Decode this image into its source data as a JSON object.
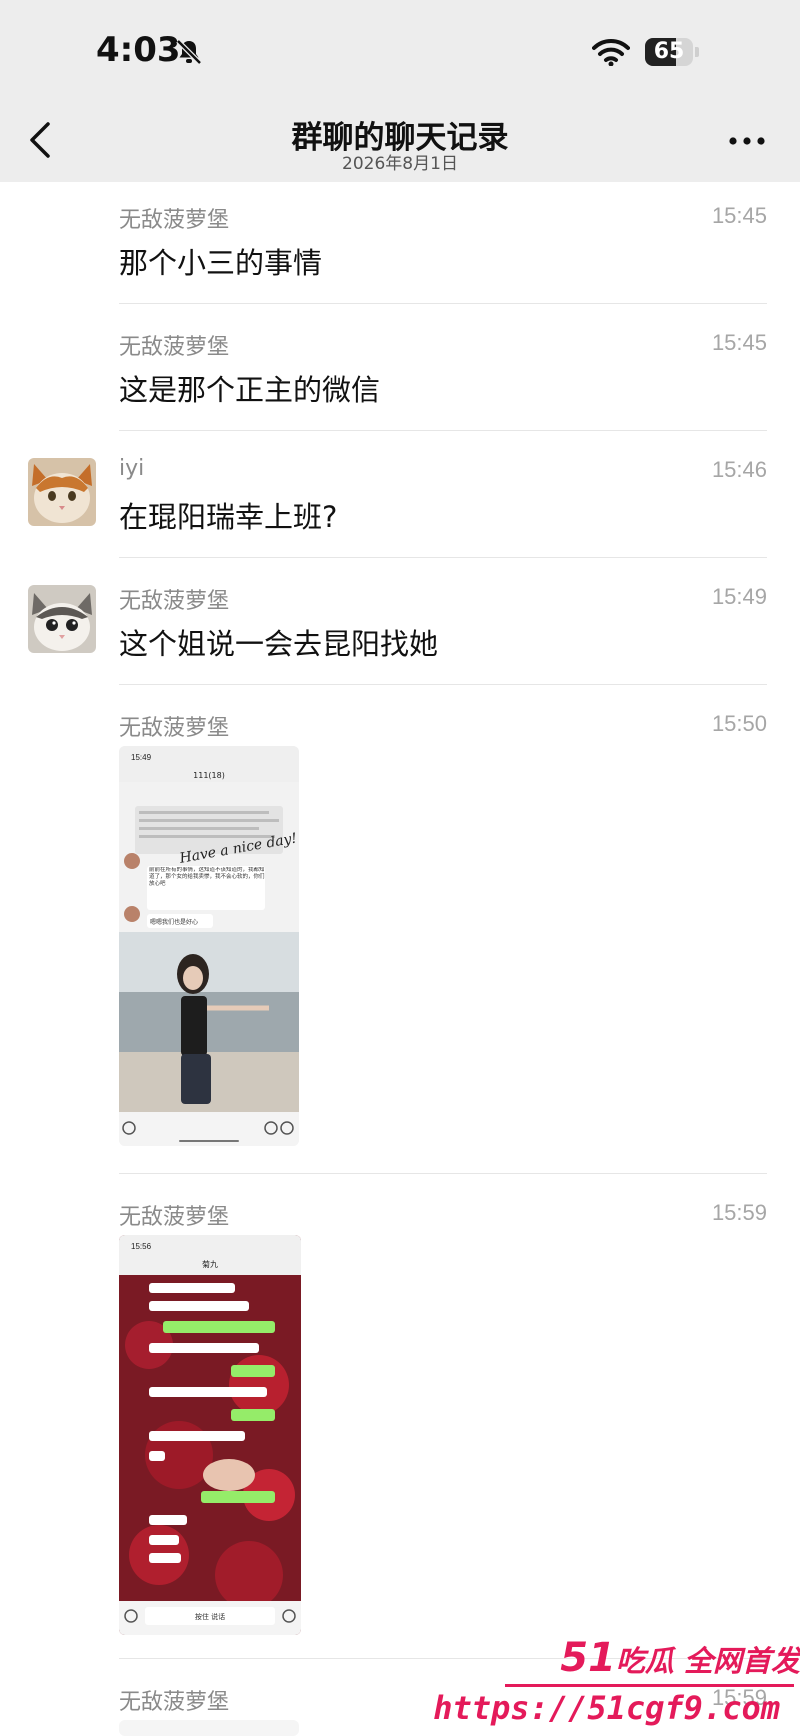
{
  "status": {
    "time": "4:03",
    "battery": "65",
    "battery_level": 0.65
  },
  "nav": {
    "title": "群聊的聊天记录",
    "subtitle": "2026年8月1日",
    "back_icon": "chevron-left-icon",
    "more_icon": "ellipsis-icon"
  },
  "messages": [
    {
      "sender": "无敌菠萝堡",
      "time": "15:45",
      "text": "那个小三的事情",
      "avatar": false
    },
    {
      "sender": "无敌菠萝堡",
      "time": "15:45",
      "text": "这是那个正主的微信",
      "avatar": false
    },
    {
      "sender": "iyi",
      "time": "15:46",
      "text": "在琨阳瑞幸上班?",
      "avatar": true
    },
    {
      "sender": "无敌菠萝堡",
      "time": "15:49",
      "text": "这个姐说一会去昆阳找她",
      "avatar": true
    },
    {
      "sender": "无敌菠萝堡",
      "time": "15:50",
      "type": "screenshot"
    },
    {
      "sender": "无敌菠萝堡",
      "time": "15:59",
      "type": "screenshot"
    },
    {
      "sender": "无敌菠萝堡",
      "time": "15:59",
      "type": "screenshot"
    }
  ],
  "shot1": {
    "time": "15:49",
    "title": "111(18)",
    "handwriting": "Have a nice day!",
    "chat_line1": "前前在所有的事情，这知道不该知道的，我都知道了，那个女的给我卖惨，我不会心软的，你们放心吧",
    "chat_line2": "嗯嗯我们也是好心"
  },
  "shot2": {
    "time": "15:56",
    "title": "菊九",
    "bottom_label": "按住 说话"
  },
  "watermark": {
    "top": "吃瓜 全网首发",
    "brand": "51",
    "url": "https://51cgf9.com"
  }
}
